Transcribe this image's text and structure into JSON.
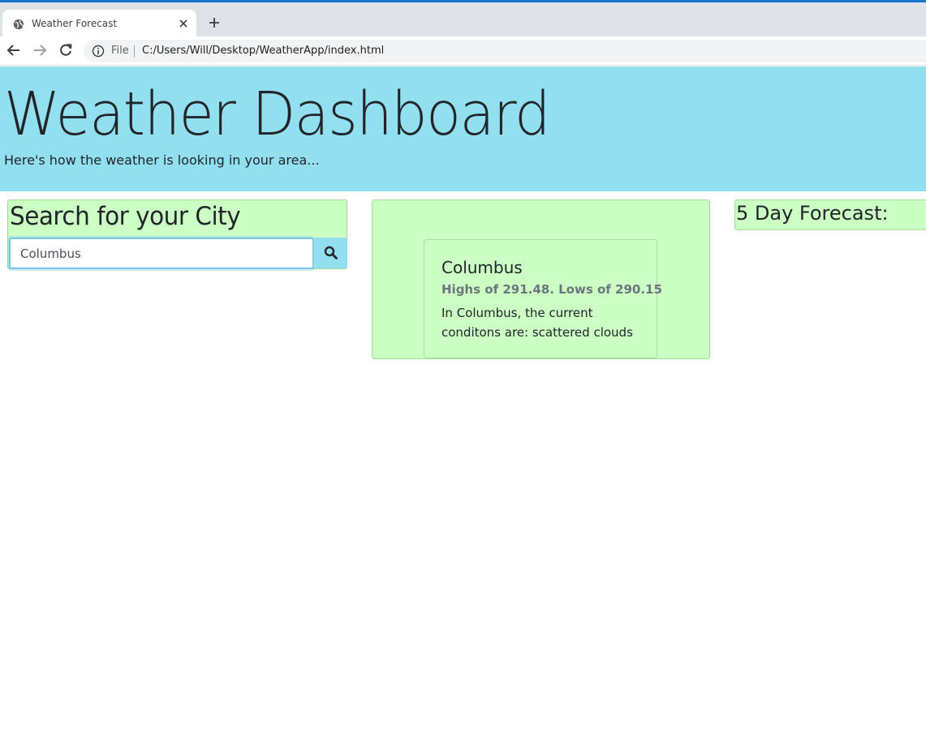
{
  "browser": {
    "tab_title": "Weather Forecast",
    "file_label": "File",
    "url": "C:/Users/Will/Desktop/WeatherApp/index.html",
    "accent_color": "#1a73c8"
  },
  "header": {
    "title": "Weather Dashboard",
    "subtitle": "Here's how the weather is looking in your area...",
    "background": "#91dfef"
  },
  "search": {
    "heading": "Search for your City",
    "input_value": "Columbus",
    "button_icon": "search-icon"
  },
  "current": {
    "city": "Columbus",
    "temps": "Highs of 291.48. Lows of 290.15",
    "conditions": "In Columbus, the current conditons are: scattered clouds"
  },
  "forecast": {
    "heading": "5 Day Forecast:"
  },
  "colors": {
    "card_green": "#ccffc4",
    "button_cyan": "#91dfef"
  }
}
